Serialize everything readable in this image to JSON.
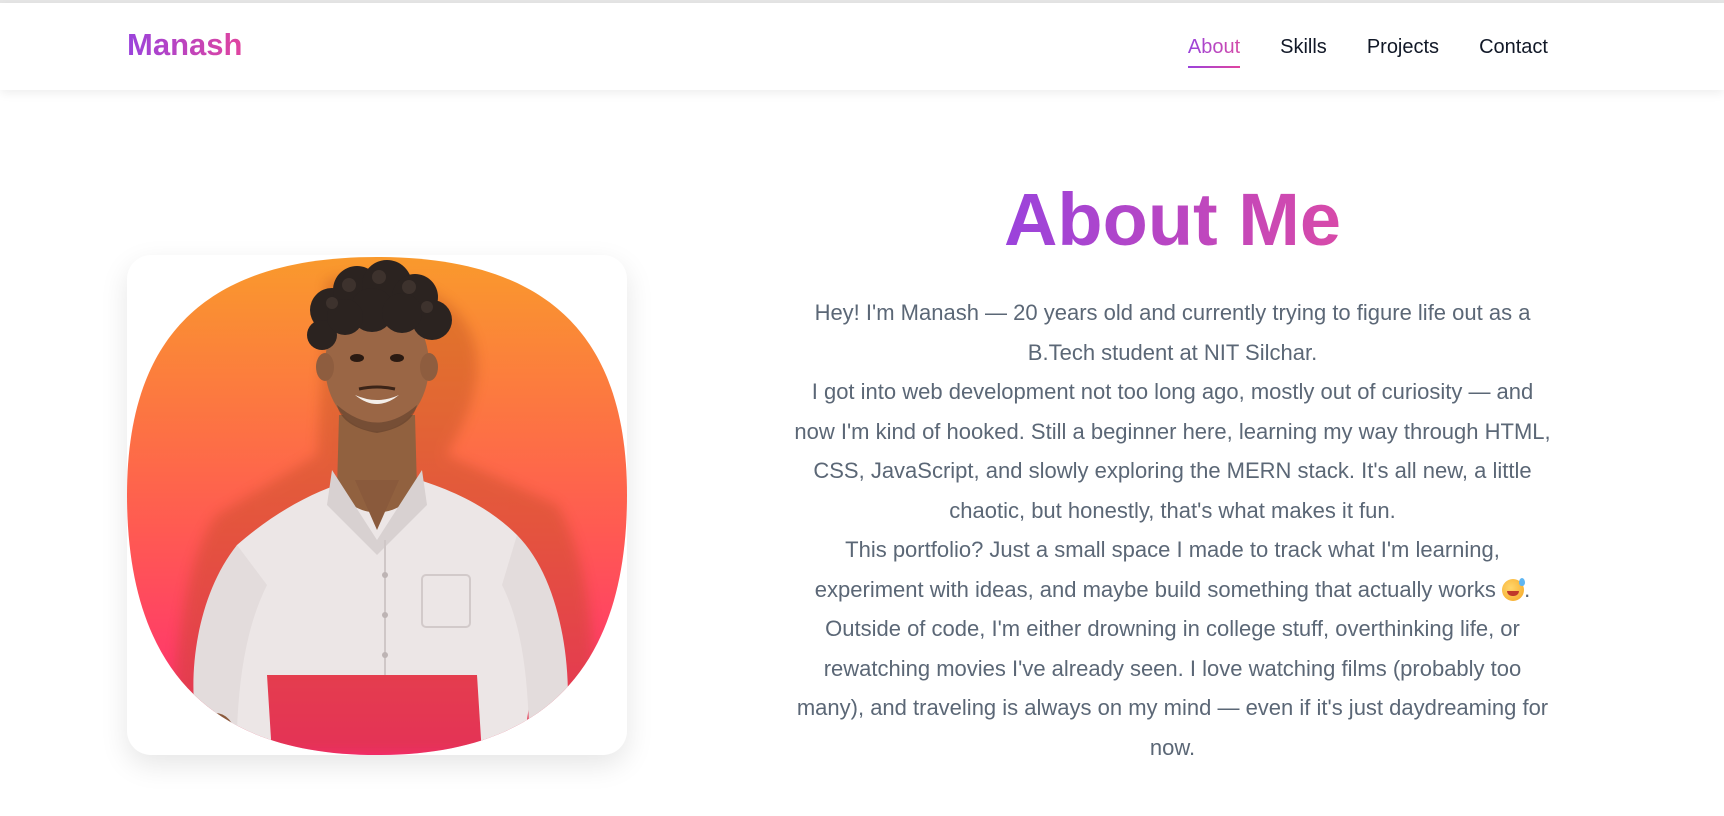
{
  "header": {
    "brand": "Manash",
    "nav": [
      {
        "label": "About",
        "active": true
      },
      {
        "label": "Skills",
        "active": false
      },
      {
        "label": "Projects",
        "active": false
      },
      {
        "label": "Contact",
        "active": false
      }
    ]
  },
  "about": {
    "title": "About Me",
    "paragraphs": [
      "Hey! I'm Manash — 20 years old and currently trying to figure life out as a B.Tech student at NIT Silchar.",
      "I got into web development not too long ago, mostly out of curiosity — and now I'm kind of hooked. Still a beginner here, learning my way through HTML, CSS, JavaScript, and slowly exploring the MERN stack. It's all new, a little chaotic, but honestly, that's what makes it fun.",
      "This portfolio? Just a small space I made to track what I'm learning, experiment with ideas, and maybe build something that actually works",
      "Outside of code, I'm either drowning in college stuff, overthinking life, or rewatching movies I've already seen. I love watching films (probably too many), and traveling is always on my mind — even if it's just daydreaming for now."
    ],
    "emoji_icon": "grinning-sweat-emoji",
    "emoji_suffix": "."
  },
  "colors": {
    "accent_start": "#9a43dc",
    "accent_end": "#e0449f",
    "photo_bg_top": "#f99a2c",
    "photo_bg_bottom": "#ff2678",
    "body_text": "#5b6776"
  }
}
